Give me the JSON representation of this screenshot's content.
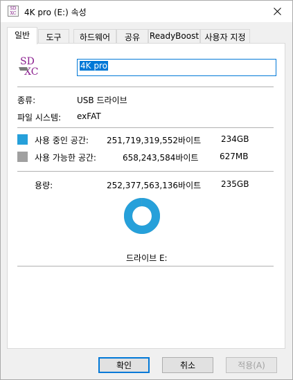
{
  "window": {
    "title": "4K pro (E:) 속성",
    "icon_text_top": "SD",
    "icon_text_bottom": "XC"
  },
  "tabs": [
    {
      "label": "일반",
      "active": true
    },
    {
      "label": "도구",
      "active": false
    },
    {
      "label": "하드웨어",
      "active": false
    },
    {
      "label": "공유",
      "active": false
    },
    {
      "label": "ReadyBoost",
      "active": false
    },
    {
      "label": "사용자 지정",
      "active": false
    }
  ],
  "general": {
    "drive_name": "4K pro",
    "drive_icon_top": "SD",
    "drive_icon_bottom": "XC",
    "type_label": "종류:",
    "type_value": "USB 드라이브",
    "fs_label": "파일 시스템:",
    "fs_value": "exFAT",
    "used": {
      "label": "사용 중인 공간:",
      "bytes": "251,719,319,552바이트",
      "size": "234GB",
      "color": "#26a0da"
    },
    "free": {
      "label": "사용 가능한 공간:",
      "bytes": "658,243,584바이트",
      "size": "627MB",
      "color": "#a0a0a0"
    },
    "capacity": {
      "label": "용량:",
      "bytes": "252,377,563,136바이트",
      "size": "235GB"
    },
    "used_fraction": 0.9974,
    "drive_label": "드라이브 E:"
  },
  "buttons": {
    "ok": "확인",
    "cancel": "취소",
    "apply": "적용(A)"
  },
  "colors": {
    "accent": "#0078d7",
    "used": "#26a0da",
    "free": "#a0a0a0"
  }
}
